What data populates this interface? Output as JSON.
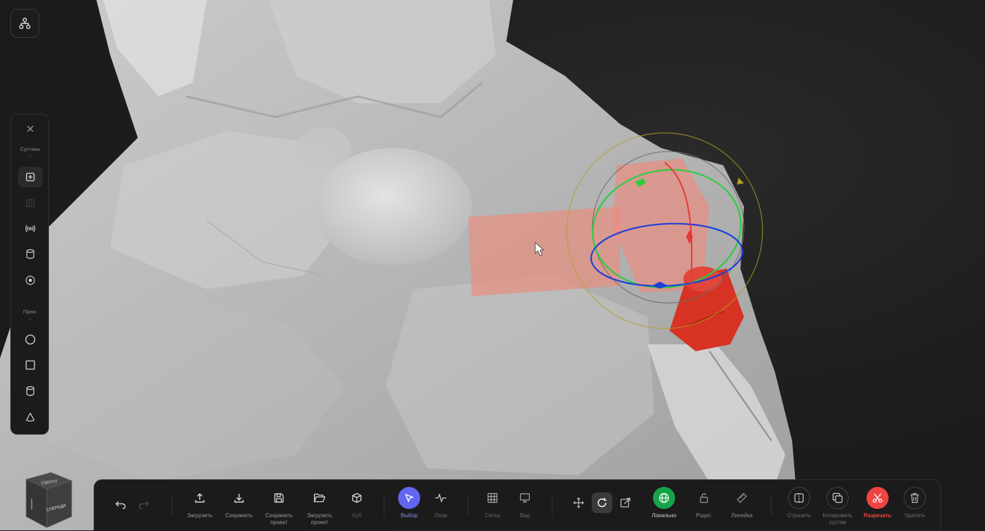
{
  "top_button": {
    "icon": "hierarchy-icon"
  },
  "side_panel": {
    "close_icon": "close-icon",
    "section_joints": "Суставы",
    "section_primitives": "Прим.",
    "joint_tools": [
      {
        "icon": "add-joint-icon",
        "active": true
      },
      {
        "icon": "grid-joint-icon",
        "disabled": true
      },
      {
        "icon": "signal-icon"
      },
      {
        "icon": "cylinder-icon"
      },
      {
        "icon": "target-icon"
      }
    ],
    "primitive_tools": [
      {
        "icon": "sphere-icon"
      },
      {
        "icon": "box-icon"
      },
      {
        "icon": "cylinder-icon"
      },
      {
        "icon": "cone-icon"
      }
    ]
  },
  "nav_cube": {
    "top_label": "СВЕРХУ",
    "front_label": "СПЕРЕДИ"
  },
  "toolbar": {
    "undo_icon": "undo-icon",
    "redo_icon": "redo-icon",
    "items": {
      "upload": "Загрузить",
      "save": "Сохранить",
      "save_project": "Сохранить\nпроект",
      "load_project": "Загрузить\nпроект",
      "cube": "Куб",
      "select": "Выбор",
      "pose": "Поза",
      "grid": "Сетка",
      "view": "Вид",
      "local": "Локально",
      "parent": "Родит.",
      "ruler": "Линейка",
      "mirror": "Отразить",
      "copy_joint": "Копировать\nсустав",
      "cut": "Разрезать",
      "delete": "Удалить"
    }
  },
  "colors": {
    "accent_select": "#6366f1",
    "accent_local": "#16a34a",
    "accent_cut": "#ef4444",
    "gizmo_x": "#e53935",
    "gizmo_y": "#2ecc40",
    "gizmo_z": "#1e3fd9",
    "gizmo_view": "#b0a21e"
  }
}
